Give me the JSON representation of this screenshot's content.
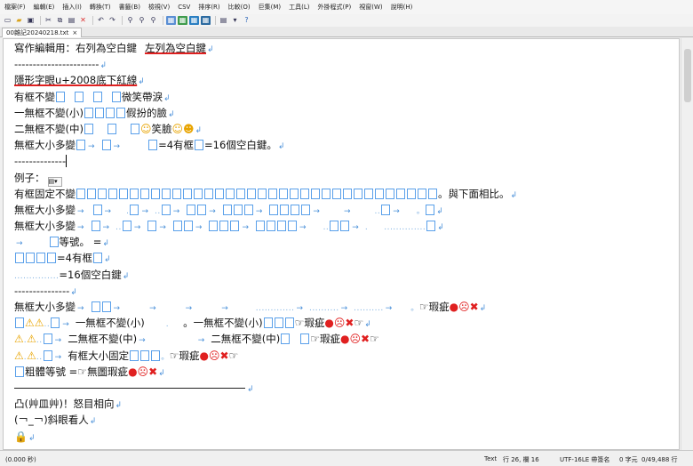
{
  "menu": [
    "檔案(F)",
    "編輯(E)",
    "插入(I)",
    "轉換(T)",
    "書籤(B)",
    "檢視(V)",
    "CSV",
    "排序(R)",
    "比較(O)",
    "巨集(M)",
    "工具(L)",
    "外掛程式(P)",
    "視窗(W)",
    "說明(H)"
  ],
  "tab": {
    "name": "00雜記20240218.txt",
    "close": "×"
  },
  "lines": {
    "l1": "寫作編輯用：右列為空白鍵",
    "l1b": "左列為空白鍵",
    "l2": "-----------------------",
    "l3": "隱形字眼u+2008底下紅線",
    "l4a": "有框不變",
    "l4b": "微笑帶淚",
    "l5a": "一無框不變(小)",
    "l5b": "假扮的臉",
    "l6a": "二無框不變(中)",
    "l6b": "笑臉",
    "l7a": "無框大小多變",
    "l7b": "=4有框",
    "l7c": "=16個空白鍵。",
    "l8": "--------------",
    "l9": "例子：",
    "l10a": "有框固定不變",
    "l10b": "。與下面相比。",
    "l11": "無框大小多變",
    "l12": "無框大小多變",
    "l13": "等號。 =",
    "l14": "=4有框",
    "l15": "=16個空白鍵",
    "l16": "---------------",
    "l17a": "無框大小多變",
    "l17b": "瑕疵",
    "l18a": "一無框不變(小)",
    "l18b": "。一無框不變(小)",
    "l18c": "瑕疵",
    "l19a": "二無框不變(中)",
    "l19b": "二無框不變(中)",
    "l19c": "瑕疵",
    "l20a": "有框大小固定",
    "l20b": "瑕疵",
    "l21a": "粗體等號 =",
    "l21b": "無圖瑕疵",
    "l22": "凸(艸皿艸)！怒目相向",
    "l23": "(￢_￢)斜眼看人"
  },
  "status": {
    "left": "(0.000 秒)",
    "mode": "Text",
    "pos": "行 26, 欄 16",
    "enc": "UTF-16LE 帶簽名",
    "size": "0 字元",
    "count": "0/49,488 行"
  }
}
